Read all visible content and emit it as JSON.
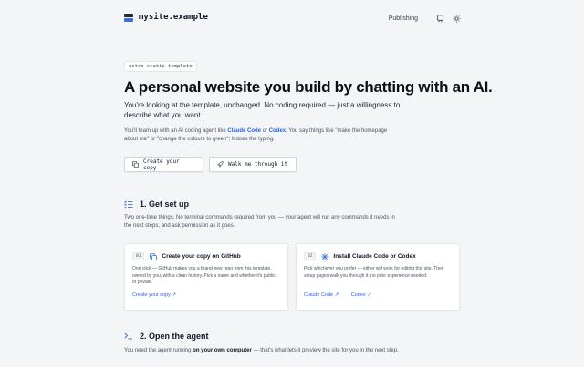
{
  "header": {
    "site_name": "mysite.example",
    "nav_publishing": "Publishing"
  },
  "hero": {
    "tag": "astro-static-template",
    "title": "A personal website you build by chatting with an AI.",
    "lead": "You're looking at the template, unchanged. No coding required — just a willingness to describe what you want.",
    "sub": {
      "before": "You'll team up with an AI coding agent like ",
      "link1": "Claude Code",
      "or": " or ",
      "link2": "Codex",
      "after": ". You say things like \"make the homepage about me\" or \"change the colours to green\"; it does the typing."
    },
    "btn_copy": "Create your copy",
    "btn_walk": "Walk me through it"
  },
  "setup": {
    "title": "1. Get set up",
    "desc": "Two one-time things. No terminal commands required from you — your agent will run any commands it needs in the next steps, and ask permission as it goes.",
    "cards": [
      {
        "num": "01",
        "title": "Create your copy on GitHub",
        "text": "One click — GitHub makes you a brand-new repo from this template, owned by you, with a clean history. Pick a name and whether it's public or private.",
        "links": [
          "Create your copy ↗"
        ]
      },
      {
        "num": "02",
        "title": "Install Claude Code or Codex",
        "text": "Pick whichever you prefer — either will work for editing this site. Their setup pages walk you through it; no prior experience needed.",
        "links": [
          "Claude Code ↗",
          "Codex ↗"
        ]
      }
    ]
  },
  "agent": {
    "title": "2. Open the agent",
    "desc_before": "You need the agent running ",
    "desc_bold": "on your own computer",
    "desc_after": " — that's what lets it preview the site for you in the next step."
  },
  "colors": {
    "accent": "#3b6fd4",
    "link": "#2563eb",
    "background": "#f4f5f7"
  }
}
